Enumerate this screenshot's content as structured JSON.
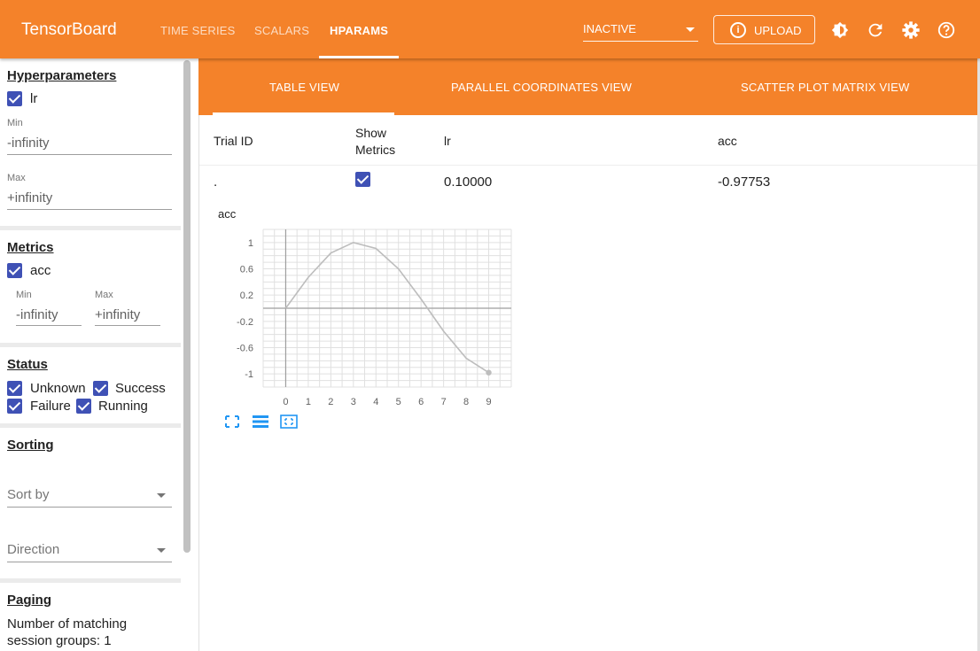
{
  "app": {
    "title": "TensorBoard"
  },
  "nav": {
    "tabs": [
      {
        "label": "TIME SERIES",
        "active": false
      },
      {
        "label": "SCALARS",
        "active": false
      },
      {
        "label": "HPARAMS",
        "active": true
      }
    ]
  },
  "toolbar": {
    "run_status": "INACTIVE",
    "upload_label": "UPLOAD",
    "icons": [
      "theme-icon",
      "reload-icon",
      "settings-icon",
      "help-icon"
    ]
  },
  "sidebar": {
    "hyperparameters": {
      "title": "Hyperparameters",
      "items": [
        {
          "label": "lr",
          "checked": true,
          "min_label": "Min",
          "min_value": "-infinity",
          "max_label": "Max",
          "max_value": "+infinity"
        }
      ]
    },
    "metrics": {
      "title": "Metrics",
      "items": [
        {
          "label": "acc",
          "checked": true,
          "min_label": "Min",
          "min_value": "-infinity",
          "max_label": "Max",
          "max_value": "+infinity"
        }
      ]
    },
    "status": {
      "title": "Status",
      "options": [
        {
          "label": "Unknown",
          "checked": true
        },
        {
          "label": "Success",
          "checked": true
        },
        {
          "label": "Failure",
          "checked": true
        },
        {
          "label": "Running",
          "checked": true
        }
      ]
    },
    "sorting": {
      "title": "Sorting",
      "sort_by_placeholder": "Sort by",
      "direction_placeholder": "Direction"
    },
    "paging": {
      "title": "Paging",
      "matching_line1": "Number of matching",
      "matching_line2": "session groups: 1"
    }
  },
  "subnav": {
    "tabs": [
      {
        "label": "TABLE VIEW",
        "active": true
      },
      {
        "label": "PARALLEL COORDINATES VIEW",
        "active": false
      },
      {
        "label": "SCATTER PLOT MATRIX VIEW",
        "active": false
      }
    ]
  },
  "table": {
    "headers": {
      "trial_id": "Trial ID",
      "show_metrics_1": "Show",
      "show_metrics_2": "Metrics",
      "lr": "lr",
      "acc": "acc"
    },
    "rows": [
      {
        "trial_id": ".",
        "show_metrics": true,
        "lr": "0.10000",
        "acc": "-0.97753"
      }
    ]
  },
  "chart_data": {
    "type": "line",
    "title": "acc",
    "x": [
      0,
      1,
      2,
      3,
      4,
      5,
      6,
      7,
      8,
      9
    ],
    "series": [
      {
        "values": [
          0.0,
          0.47,
          0.84,
          1.0,
          0.91,
          0.6,
          0.14,
          -0.35,
          -0.76,
          -0.98
        ]
      }
    ],
    "xticks": [
      "0",
      "1",
      "2",
      "3",
      "4",
      "5",
      "6",
      "7",
      "8",
      "9"
    ],
    "yticks": [
      "1",
      "0.6",
      "0.2",
      "-0.2",
      "-0.6",
      "-1"
    ],
    "xlim": [
      -1,
      10
    ],
    "ylim": [
      -1.2,
      1.2
    ],
    "grid": true,
    "colors": {
      "line": "#bdbdbd",
      "grid": "#e0e0e0",
      "axis": "#9e9e9e"
    }
  },
  "chart_controls": {
    "icons": [
      "fit-to-screen-icon",
      "toggle-log-scale-icon",
      "fit-domain-icon"
    ],
    "color": "#2196f3"
  },
  "colors": {
    "brand": "#f4822a",
    "checkbox": "#3f51b5"
  }
}
